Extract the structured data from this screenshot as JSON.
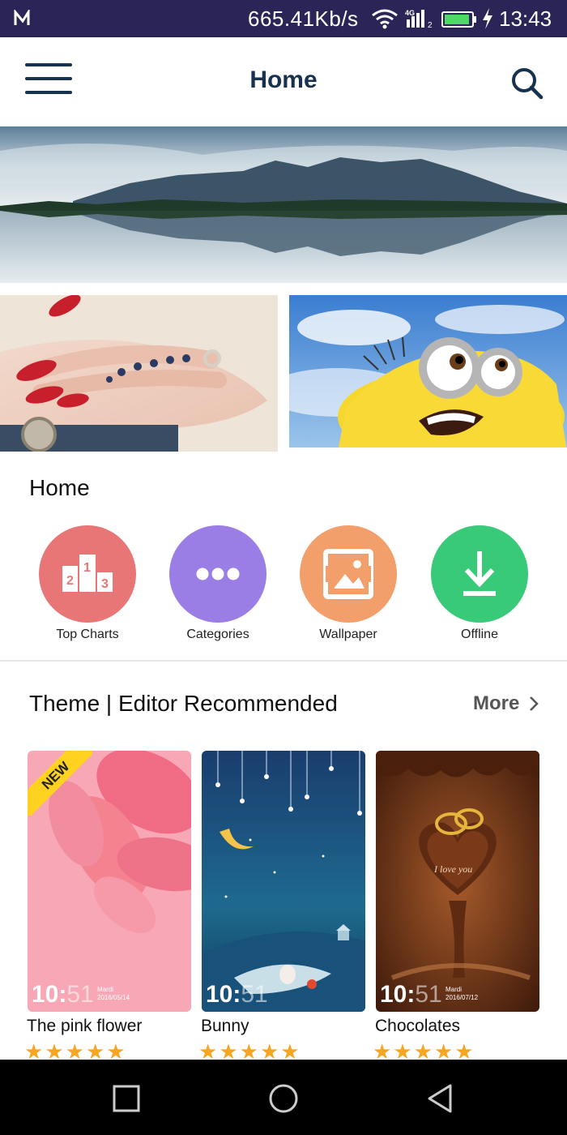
{
  "status_bar": {
    "net_speed": "665.41Kb/s",
    "network_type": "4G",
    "sim_slot": "2",
    "time": "13:43"
  },
  "app_bar": {
    "title": "Home",
    "menu_icon": "hamburger-menu-icon",
    "search_icon": "search-icon"
  },
  "banners": [
    {
      "name": "mountain-lake-reflection"
    },
    {
      "name": "tattooed-hand"
    },
    {
      "name": "minion"
    }
  ],
  "home_section": {
    "title": "Home",
    "shortcuts": [
      {
        "label": "Top Charts",
        "icon": "podium-icon",
        "color": "#e87677"
      },
      {
        "label": "Categories",
        "icon": "more-dots-icon",
        "color": "#9b7de6"
      },
      {
        "label": "Wallpaper",
        "icon": "image-icon",
        "color": "#f39f6b"
      },
      {
        "label": "Offline",
        "icon": "download-icon",
        "color": "#38c979"
      }
    ]
  },
  "theme_section": {
    "title": "Theme | Editor Recommended",
    "more_label": "More",
    "themes": [
      {
        "name": "The pink flower",
        "badge": "NEW",
        "clock_main": "10:",
        "clock_dim": "51",
        "day": "Mardi",
        "date": "2016/05/14",
        "rating": 5
      },
      {
        "name": "Bunny",
        "clock_main": "10:",
        "clock_dim": "51",
        "rating": 5
      },
      {
        "name": "Chocolates",
        "clock_main": "10:",
        "clock_dim": "51",
        "day": "Mardi",
        "date": "2016/07/12",
        "rating": 5
      }
    ]
  },
  "colors": {
    "status_bar": "#2b2456",
    "app_title": "#16324f",
    "star": "#f5a623",
    "new_badge": "#ffd21f"
  },
  "nav_bar": {
    "recent_icon": "recent-apps-icon",
    "home_icon": "home-circle-icon",
    "back_icon": "back-triangle-icon"
  }
}
